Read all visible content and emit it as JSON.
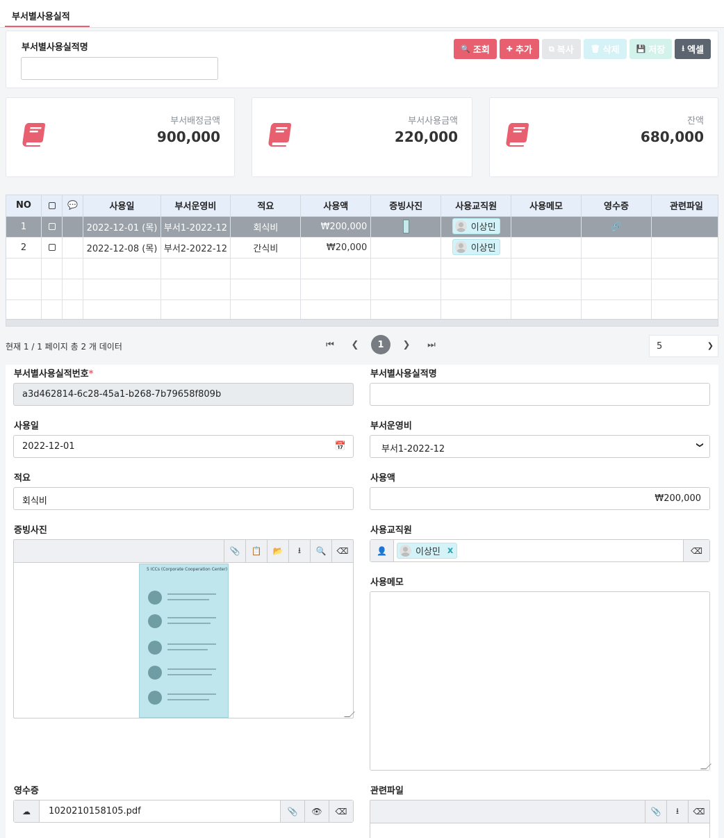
{
  "tab": {
    "label": "부서별사용실적"
  },
  "search": {
    "label": "부서별사용실적명",
    "value": ""
  },
  "buttons": {
    "search": "조회",
    "add": "추가",
    "copy": "복사",
    "delete": "삭제",
    "save": "저장",
    "excel": "엑셀"
  },
  "summary": [
    {
      "label": "부서배정금액",
      "value": "900,000"
    },
    {
      "label": "부서사용금액",
      "value": "220,000"
    },
    {
      "label": "잔액",
      "value": "680,000"
    }
  ],
  "grid": {
    "columns": [
      "NO",
      "",
      "",
      "사용일",
      "부서운영비",
      "적요",
      "사용액",
      "증빙사진",
      "사용교직원",
      "사용메모",
      "영수증",
      "관련파일"
    ],
    "rows": [
      {
        "no": "1",
        "date": "2022-12-01 (목)",
        "budget": "부서1-2022-12",
        "summary": "회식비",
        "amount": "₩200,000",
        "staff": "이상민",
        "selected": true
      },
      {
        "no": "2",
        "date": "2022-12-08 (목)",
        "budget": "부서2-2022-12",
        "summary": "간식비",
        "amount": "₩20,000",
        "staff": "이상민",
        "selected": false
      }
    ]
  },
  "pagination": {
    "info": "현재 1 / 1 페이지 총 2 개 데이터",
    "current": "1",
    "page_size": "5"
  },
  "form": {
    "id_label": "부서별사용실적번호",
    "id_value": "a3d462814-6c28-45a1-b268-7b79658f809b",
    "name_label": "부서별사용실적명",
    "name_value": "",
    "date_label": "사용일",
    "date_value": "2022-12-01",
    "budget_label": "부서운영비",
    "budget_value": "부서1-2022-12",
    "summary_label": "적요",
    "summary_value": "회식비",
    "amount_label": "사용액",
    "amount_value": "₩200,000",
    "photo_label": "증빙사진",
    "staff_label": "사용교직원",
    "staff_value": "이상민",
    "memo_label": "사용메모",
    "receipt_label": "영수증",
    "receipt_file": "1020210158105.pdf",
    "files_label": "관련파일"
  },
  "preview": {
    "title": "5 ICCs (Corporate Cooperation Center)"
  },
  "colors": {
    "accent": "#e8606f",
    "header": "#e6eefa",
    "selected_row": "#9aa1a9",
    "chip": "#d3f3f8"
  }
}
